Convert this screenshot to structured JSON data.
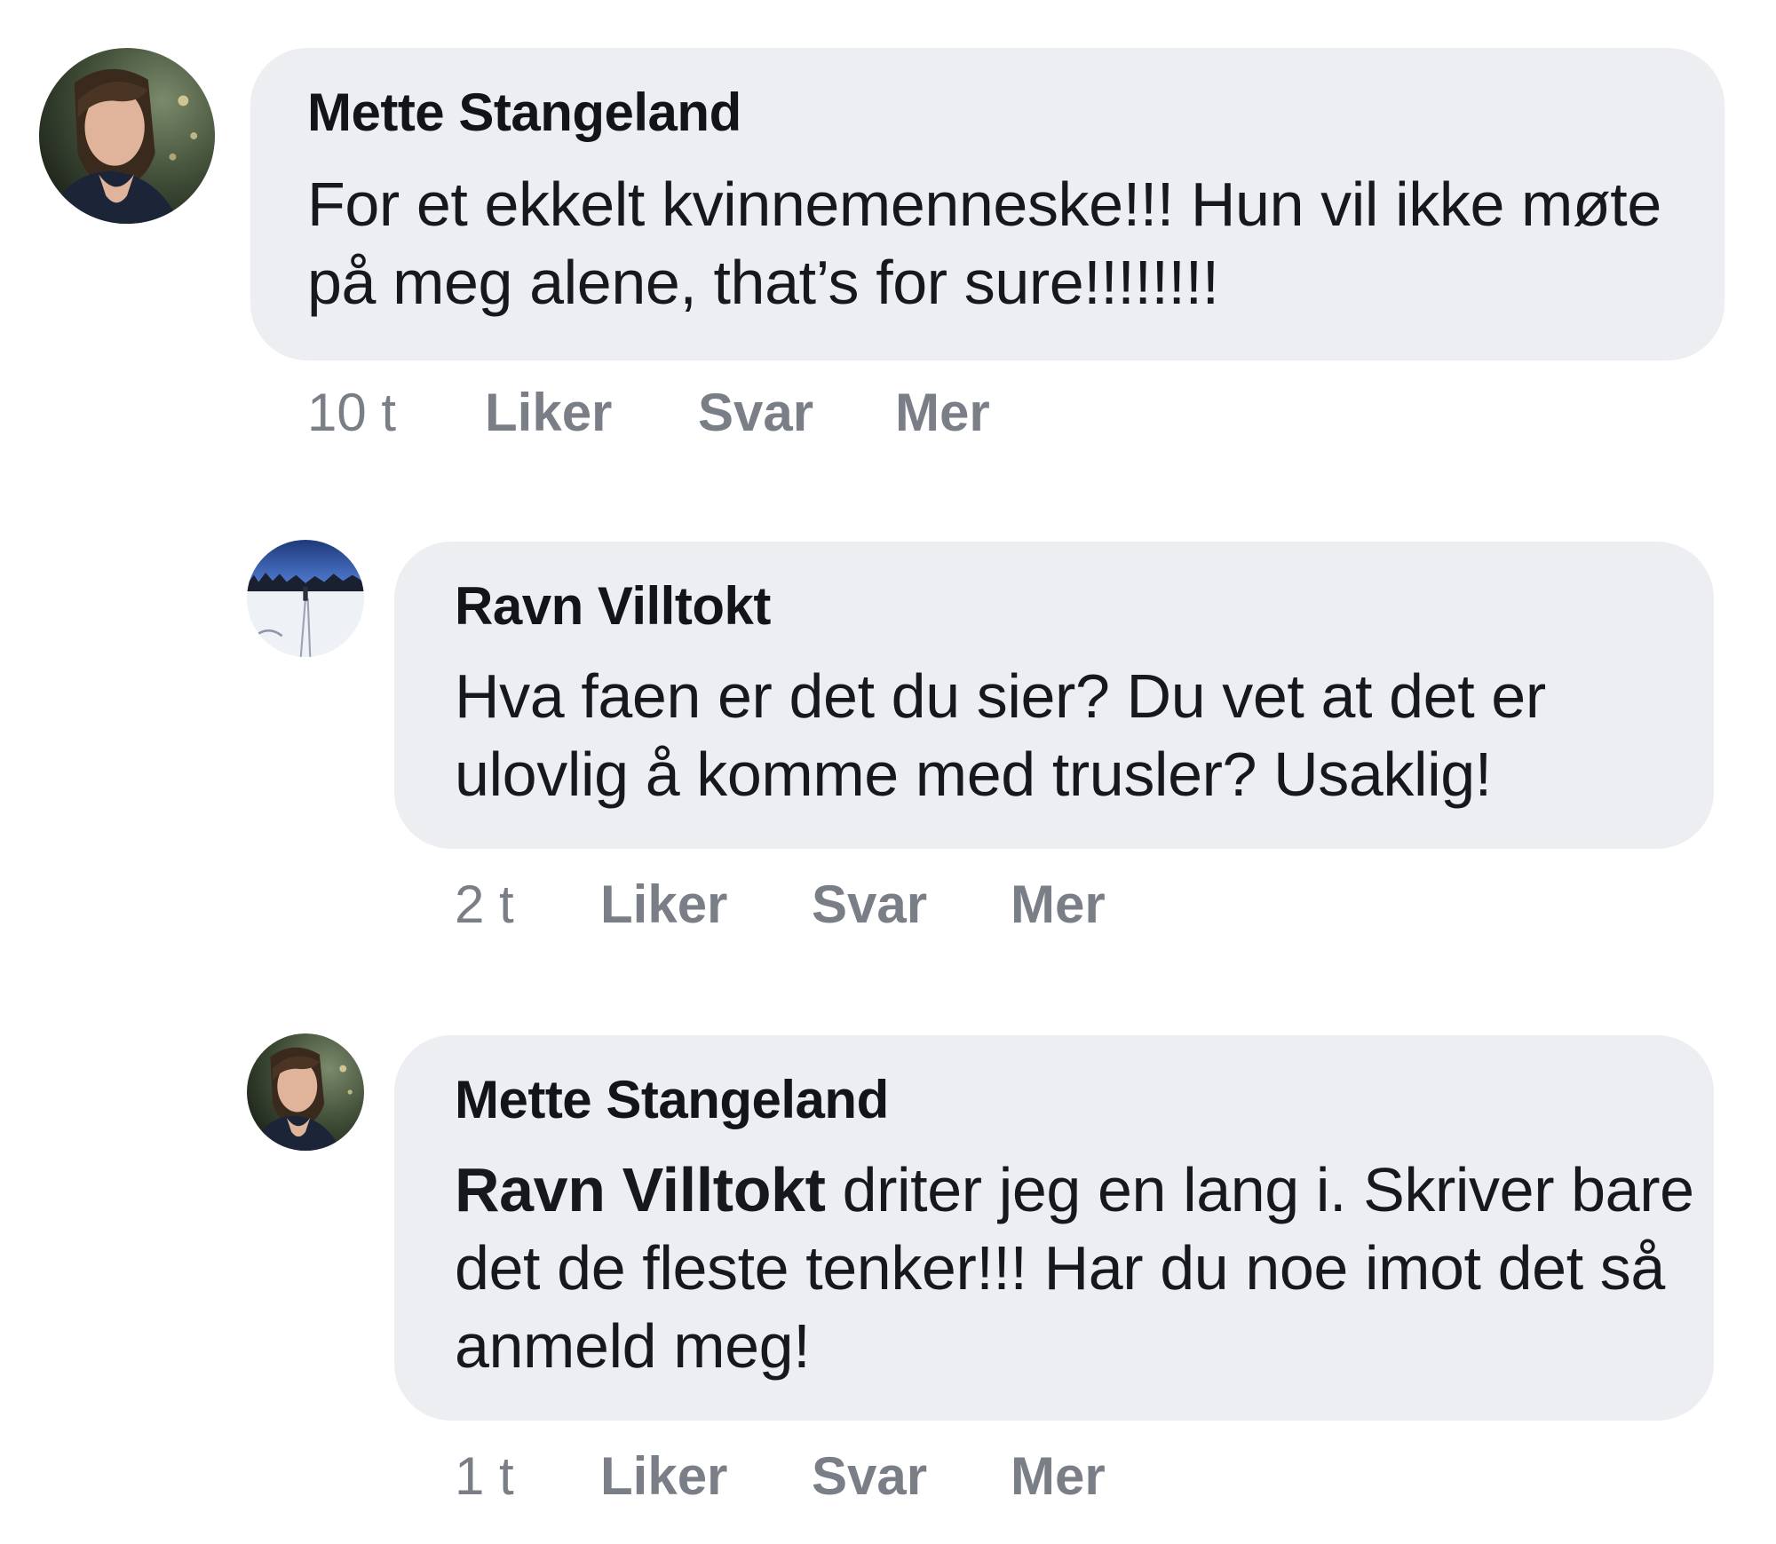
{
  "comments": [
    {
      "author": "Mette Stangeland",
      "text": "For et ekkelt kvinnemenneske!!! Hun vil ikke møte på meg alene, that’s for sure!!!!!!!!",
      "time": "10 t",
      "like": "Liker",
      "reply": "Svar",
      "more": "Mer"
    },
    {
      "author": "Ravn Villtokt",
      "text": "Hva faen er det du sier? Du vet at det er ulovlig å komme med trusler? Usaklig!",
      "time": "2 t",
      "like": "Liker",
      "reply": "Svar",
      "more": "Mer"
    },
    {
      "author": "Mette Stangeland",
      "mention": "Ravn Villtokt",
      "text": " driter jeg en lang i. Skriver bare det de fleste tenker!!! Har du noe imot det så anmeld meg!",
      "time": "1 t",
      "like": "Liker",
      "reply": "Svar",
      "more": "Mer"
    }
  ]
}
